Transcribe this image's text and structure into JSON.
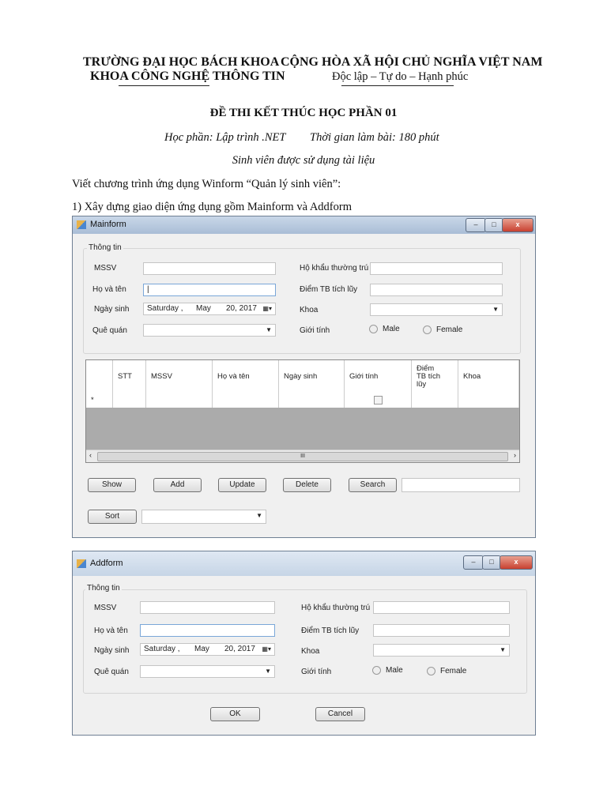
{
  "header": {
    "left_line1": "TRƯỜNG ĐẠI HỌC BÁCH KHOA",
    "left_line2": "KHOA CÔNG NGHỆ THÔNG TIN",
    "right_line1": "CỘNG HÒA XÃ HỘI CHỦ NGHĨA VIỆT NAM",
    "right_line2": "Độc lập – Tự do – Hạnh phúc"
  },
  "exam": {
    "title": "ĐỀ THI KẾT THÚC HỌC PHẦN 01",
    "course": "Học phần: Lập trình .NET",
    "time": "Thời gian làm bài: 180 phút",
    "note": "Sinh viên được sử dụng tài liệu",
    "intro": "Viết chương trình ứng dụng Winform “Quản lý sinh viên”:",
    "task1": "1) Xây dựng giao diện ứng dụng gồm Mainform và Addform"
  },
  "mainform": {
    "title": "Mainform",
    "group": "Thông tin",
    "labels": {
      "mssv": "MSSV",
      "hoten": "Họ và tên",
      "ngaysinh": "Ngày sinh",
      "quequan": "Quê quán",
      "hokhau": "Hộ khẩu thường trú",
      "diem": "Điểm TB tích lũy",
      "khoa": "Khoa",
      "gioitinh": "Giới tính"
    },
    "date": {
      "day": "Saturday ,",
      "month": "May",
      "date": "20, 2017"
    },
    "male": "Male",
    "female": "Female",
    "columns": [
      "STT",
      "MSSV",
      "Họ và tên",
      "Ngày sinh",
      "Giới tính",
      "Điểm TB tích lũy",
      "Khoa"
    ],
    "new_row_marker": "*",
    "scroll_thumb": "III",
    "buttons": {
      "show": "Show",
      "add": "Add",
      "update": "Update",
      "delete": "Delete",
      "search": "Search",
      "sort": "Sort"
    }
  },
  "addform": {
    "title": "Addform",
    "group": "Thông tin",
    "labels": {
      "mssv": "MSSV",
      "hoten": "Họ và tên",
      "ngaysinh": "Ngày sinh",
      "quequan": "Quê quán",
      "hokhau": "Hộ khẩu thường trú",
      "diem": "Điểm TB tích lũy",
      "khoa": "Khoa",
      "gioitinh": "Giới tính"
    },
    "date": {
      "day": "Saturday ,",
      "month": "May",
      "date": "20, 2017"
    },
    "male": "Male",
    "female": "Female",
    "buttons": {
      "ok": "OK",
      "cancel": "Cancel"
    }
  }
}
